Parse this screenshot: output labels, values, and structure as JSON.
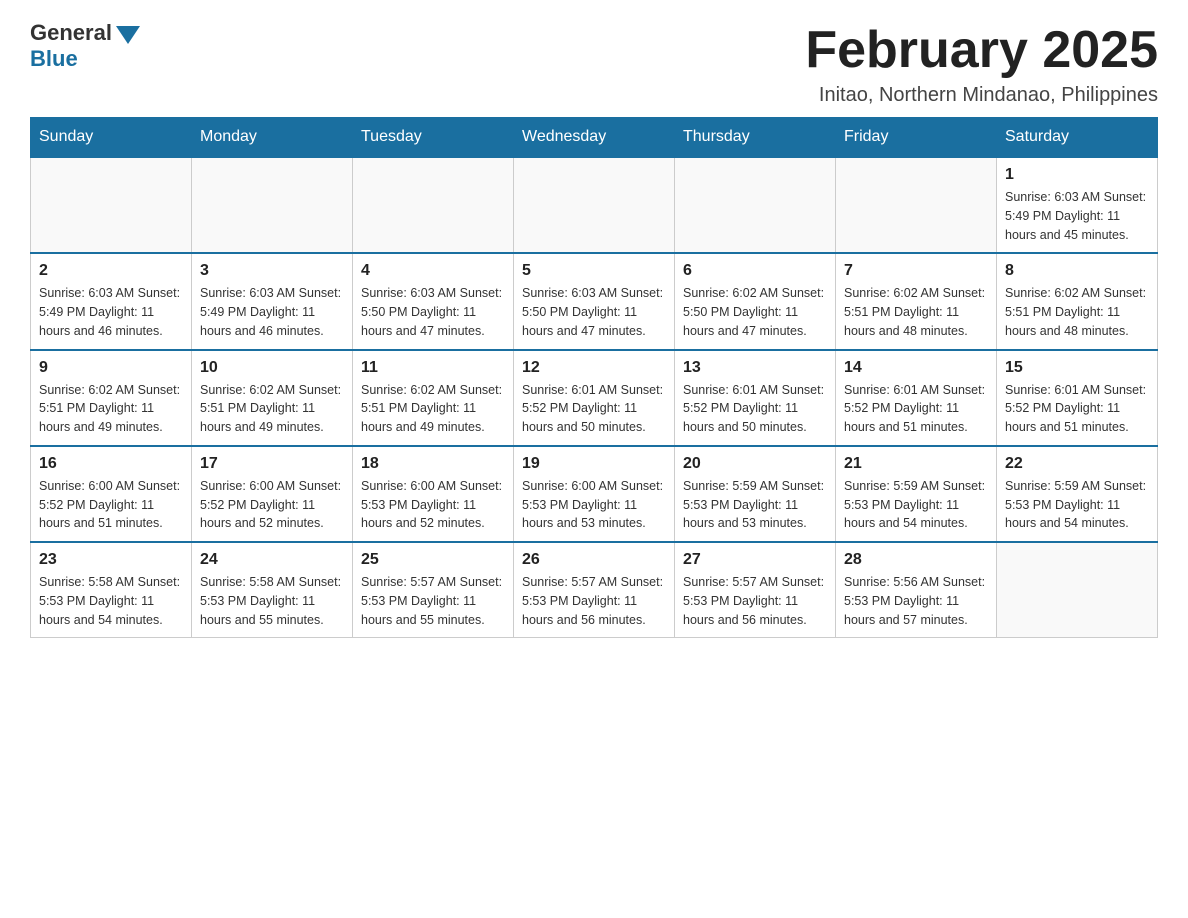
{
  "logo": {
    "general": "General",
    "blue": "Blue"
  },
  "header": {
    "month_year": "February 2025",
    "location": "Initao, Northern Mindanao, Philippines"
  },
  "weekdays": [
    "Sunday",
    "Monday",
    "Tuesday",
    "Wednesday",
    "Thursday",
    "Friday",
    "Saturday"
  ],
  "weeks": [
    [
      {
        "day": "",
        "info": ""
      },
      {
        "day": "",
        "info": ""
      },
      {
        "day": "",
        "info": ""
      },
      {
        "day": "",
        "info": ""
      },
      {
        "day": "",
        "info": ""
      },
      {
        "day": "",
        "info": ""
      },
      {
        "day": "1",
        "info": "Sunrise: 6:03 AM\nSunset: 5:49 PM\nDaylight: 11 hours\nand 45 minutes."
      }
    ],
    [
      {
        "day": "2",
        "info": "Sunrise: 6:03 AM\nSunset: 5:49 PM\nDaylight: 11 hours\nand 46 minutes."
      },
      {
        "day": "3",
        "info": "Sunrise: 6:03 AM\nSunset: 5:49 PM\nDaylight: 11 hours\nand 46 minutes."
      },
      {
        "day": "4",
        "info": "Sunrise: 6:03 AM\nSunset: 5:50 PM\nDaylight: 11 hours\nand 47 minutes."
      },
      {
        "day": "5",
        "info": "Sunrise: 6:03 AM\nSunset: 5:50 PM\nDaylight: 11 hours\nand 47 minutes."
      },
      {
        "day": "6",
        "info": "Sunrise: 6:02 AM\nSunset: 5:50 PM\nDaylight: 11 hours\nand 47 minutes."
      },
      {
        "day": "7",
        "info": "Sunrise: 6:02 AM\nSunset: 5:51 PM\nDaylight: 11 hours\nand 48 minutes."
      },
      {
        "day": "8",
        "info": "Sunrise: 6:02 AM\nSunset: 5:51 PM\nDaylight: 11 hours\nand 48 minutes."
      }
    ],
    [
      {
        "day": "9",
        "info": "Sunrise: 6:02 AM\nSunset: 5:51 PM\nDaylight: 11 hours\nand 49 minutes."
      },
      {
        "day": "10",
        "info": "Sunrise: 6:02 AM\nSunset: 5:51 PM\nDaylight: 11 hours\nand 49 minutes."
      },
      {
        "day": "11",
        "info": "Sunrise: 6:02 AM\nSunset: 5:51 PM\nDaylight: 11 hours\nand 49 minutes."
      },
      {
        "day": "12",
        "info": "Sunrise: 6:01 AM\nSunset: 5:52 PM\nDaylight: 11 hours\nand 50 minutes."
      },
      {
        "day": "13",
        "info": "Sunrise: 6:01 AM\nSunset: 5:52 PM\nDaylight: 11 hours\nand 50 minutes."
      },
      {
        "day": "14",
        "info": "Sunrise: 6:01 AM\nSunset: 5:52 PM\nDaylight: 11 hours\nand 51 minutes."
      },
      {
        "day": "15",
        "info": "Sunrise: 6:01 AM\nSunset: 5:52 PM\nDaylight: 11 hours\nand 51 minutes."
      }
    ],
    [
      {
        "day": "16",
        "info": "Sunrise: 6:00 AM\nSunset: 5:52 PM\nDaylight: 11 hours\nand 51 minutes."
      },
      {
        "day": "17",
        "info": "Sunrise: 6:00 AM\nSunset: 5:52 PM\nDaylight: 11 hours\nand 52 minutes."
      },
      {
        "day": "18",
        "info": "Sunrise: 6:00 AM\nSunset: 5:53 PM\nDaylight: 11 hours\nand 52 minutes."
      },
      {
        "day": "19",
        "info": "Sunrise: 6:00 AM\nSunset: 5:53 PM\nDaylight: 11 hours\nand 53 minutes."
      },
      {
        "day": "20",
        "info": "Sunrise: 5:59 AM\nSunset: 5:53 PM\nDaylight: 11 hours\nand 53 minutes."
      },
      {
        "day": "21",
        "info": "Sunrise: 5:59 AM\nSunset: 5:53 PM\nDaylight: 11 hours\nand 54 minutes."
      },
      {
        "day": "22",
        "info": "Sunrise: 5:59 AM\nSunset: 5:53 PM\nDaylight: 11 hours\nand 54 minutes."
      }
    ],
    [
      {
        "day": "23",
        "info": "Sunrise: 5:58 AM\nSunset: 5:53 PM\nDaylight: 11 hours\nand 54 minutes."
      },
      {
        "day": "24",
        "info": "Sunrise: 5:58 AM\nSunset: 5:53 PM\nDaylight: 11 hours\nand 55 minutes."
      },
      {
        "day": "25",
        "info": "Sunrise: 5:57 AM\nSunset: 5:53 PM\nDaylight: 11 hours\nand 55 minutes."
      },
      {
        "day": "26",
        "info": "Sunrise: 5:57 AM\nSunset: 5:53 PM\nDaylight: 11 hours\nand 56 minutes."
      },
      {
        "day": "27",
        "info": "Sunrise: 5:57 AM\nSunset: 5:53 PM\nDaylight: 11 hours\nand 56 minutes."
      },
      {
        "day": "28",
        "info": "Sunrise: 5:56 AM\nSunset: 5:53 PM\nDaylight: 11 hours\nand 57 minutes."
      },
      {
        "day": "",
        "info": ""
      }
    ]
  ]
}
